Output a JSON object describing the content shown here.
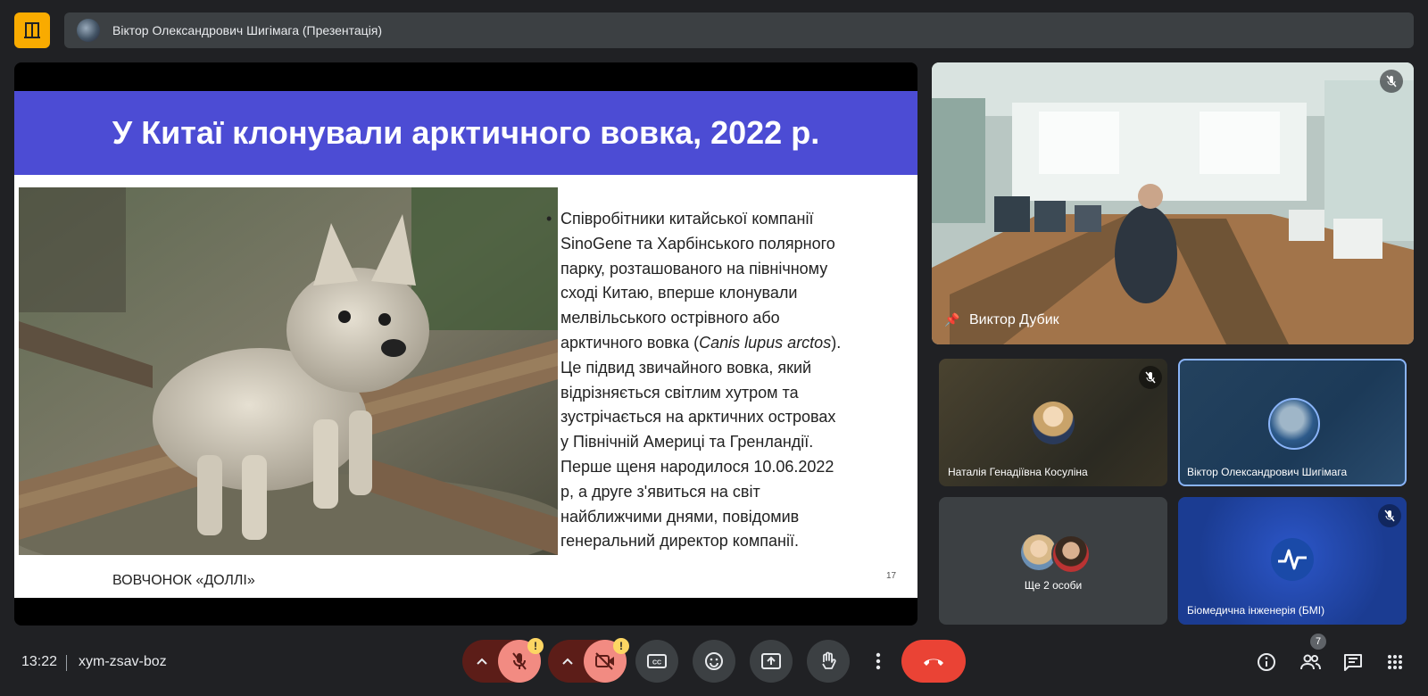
{
  "header": {
    "presenter_title": "Віктор Олександрович Шигімага (Презентація)"
  },
  "slide": {
    "title": "У Китаї клонували арктичного вовка, 2022 р.",
    "body_lines": [
      "Співробітники китайської компанії",
      "SinoGene та Харбінського полярного",
      "парку, розташованого на північному",
      "сході Китаю, вперше клонували",
      "мелвільського острівного або",
      "арктичного вовка (",
      "Canis lupus arctos",
      ").",
      "Це підвид звичайного вовка, який",
      "відрізняється світлим хутром та",
      "зустрічається на арктичних островах",
      "у Північній Америці та Гренландії.",
      "Перше щеня народилося 10.06.2022",
      "р, а друге з'явиться на світ",
      "найближчими днями, повідомив",
      "генеральний директор компанії."
    ],
    "caption": "ВОВЧОНОК «ДОЛЛІ»",
    "page_number": "17"
  },
  "participants": {
    "main": {
      "name": "Виктор Дубик",
      "muted": true,
      "pinned": true
    },
    "tiles": [
      {
        "name": "Наталія Генадіївна Косуліна",
        "muted": true
      },
      {
        "name": "Віктор Олександрович Шигімага",
        "muted": false,
        "active": true
      },
      {
        "name": "Ще 2 особи"
      },
      {
        "name": "Біомедична інженерія (БМІ)",
        "muted": true
      }
    ]
  },
  "footer": {
    "time": "13:22",
    "meeting_code": "xym-zsav-boz",
    "mic_warning": "!",
    "cam_warning": "!",
    "people_count": "7"
  },
  "colors": {
    "background": "#202124",
    "slide_header": "#4c4cd4",
    "danger": "#ea4335",
    "muted_btn": "#f28b82",
    "app_logo": "#f9ab00",
    "active_border": "#8ab4f8"
  }
}
